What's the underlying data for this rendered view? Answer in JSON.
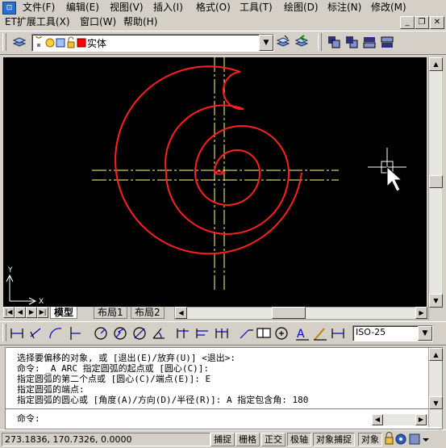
{
  "menu": [
    {
      "label": "文件(F)"
    },
    {
      "label": "编辑(E)"
    },
    {
      "label": "视图(V)"
    },
    {
      "label": "插入(I)"
    },
    {
      "label": "格式(O)"
    },
    {
      "label": "工具(T)"
    },
    {
      "label": "绘图(D)"
    },
    {
      "label": "标注(N)"
    },
    {
      "label": "修改(M)"
    },
    {
      "label": "ET扩展工具(X)"
    },
    {
      "label": "窗口(W)"
    },
    {
      "label": "帮助(H)"
    }
  ],
  "layer": {
    "name": "实体",
    "color": "#ff0000"
  },
  "tabs": [
    {
      "label": "模型"
    },
    {
      "label": "布局1"
    },
    {
      "label": "布局2"
    }
  ],
  "dimstyle": {
    "value": "ISO-25"
  },
  "command_history": [
    "选择要偏移的对象, 或 [退出(E)/放弃(U)] <退出>:",
    "命令: _A ARC 指定圆弧的起点或 [圆心(C)]:",
    "指定圆弧的第二个点或 [圆心(C)/端点(E)]: E",
    "指定圆弧的端点:",
    "指定圆弧的圆心或 [角度(A)/方向(D)/半径(R)]: A 指定包含角: 180"
  ],
  "command_prompt": "命令:",
  "status": {
    "coordinates": "273.1836, 170.7326, 0.0000",
    "buttons": [
      {
        "label": "捕捉"
      },
      {
        "label": "栅格"
      },
      {
        "label": "正交"
      },
      {
        "label": "极轴"
      },
      {
        "label": "对象捕捉"
      },
      {
        "label": "对象"
      }
    ]
  },
  "ucs": {
    "x": "X",
    "y": "Y"
  },
  "colors": {
    "canvas": "#000000",
    "spiral": "#ff2020",
    "centerline": "#ffff80"
  }
}
